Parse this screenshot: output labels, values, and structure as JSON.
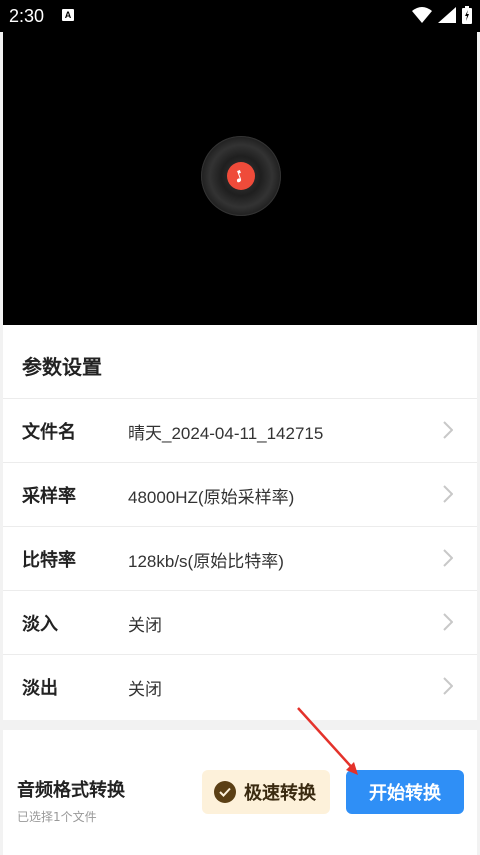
{
  "status_bar": {
    "time": "2:30",
    "a_badge": "A",
    "icons": [
      "wifi-icon",
      "signal-icon",
      "battery-icon"
    ]
  },
  "player": {
    "icon": "music-disc-icon",
    "accent": "#ef4b3a"
  },
  "params": {
    "title": "参数设置",
    "rows": [
      {
        "label": "文件名",
        "value": "晴天_2024-04-11_142715"
      },
      {
        "label": "采样率",
        "value": "48000HZ(原始采样率)"
      },
      {
        "label": "比特率",
        "value": "128kb/s(原始比特率)"
      },
      {
        "label": "淡入",
        "value": "关闭"
      },
      {
        "label": "淡出",
        "value": "关闭"
      }
    ]
  },
  "bottom": {
    "title": "音频格式转换",
    "subtitle": "已选择1个文件",
    "fast_label": "极速转换",
    "start_label": "开始转换",
    "start_color": "#2f8ff6",
    "fast_color": "#fdf1da"
  }
}
